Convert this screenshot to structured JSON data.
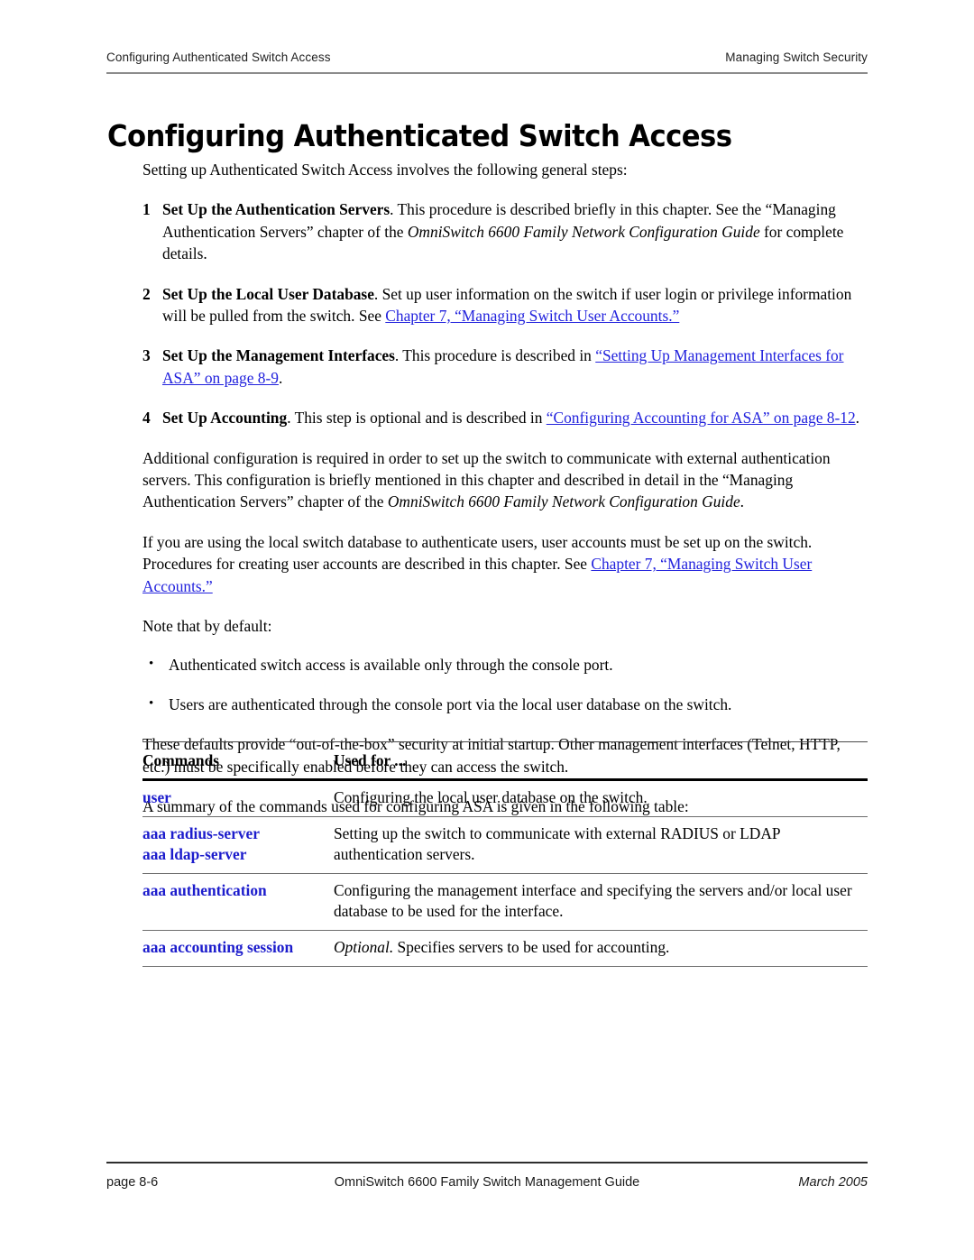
{
  "header": {
    "left": "Configuring Authenticated Switch Access",
    "right": "Managing Switch Security"
  },
  "title": "Configuring Authenticated Switch Access",
  "intro": "Setting up Authenticated Switch Access involves the following general steps:",
  "steps": [
    {
      "num": "1",
      "lead": "Set Up the Authentication Servers",
      "text_a": ". This procedure is described briefly in this chapter. See the “Managing Authentication Servers” chapter of the ",
      "italic": "OmniSwitch 6600 Family Network Configuration Guide",
      "text_b": " for complete details."
    },
    {
      "num": "2",
      "lead": "Set Up the Local User Database",
      "text_a": ". Set up user information on the switch if user login or privilege information will be pulled from the switch. See ",
      "link": "Chapter 7, “Managing Switch User Accounts.”",
      "text_b": ""
    },
    {
      "num": "3",
      "lead": "Set Up the Management Interfaces",
      "text_a": ". This procedure is described in ",
      "link": "“Setting Up Management Interfaces for ASA” on page 8-9",
      "text_b": "."
    },
    {
      "num": "4",
      "lead": "Set Up Accounting",
      "text_a": ". This step is optional and is described in ",
      "link": "“Configuring Accounting for ASA” on page 8-12",
      "text_b": "."
    }
  ],
  "para_additional": {
    "text_a": "Additional configuration is required in order to set up the switch to communicate with external authentication servers. This configuration is briefly mentioned in this chapter and described in detail in the “Managing Authentication Servers” chapter of the ",
    "italic": "OmniSwitch 6600 Family Network Configuration Guide",
    "text_b": "."
  },
  "para_localdb": {
    "text_a": "If you are using the local switch database to authenticate users, user accounts must be set up on the switch. Procedures for creating user accounts are described in this chapter. See ",
    "link": "Chapter 7, “Managing Switch User Accounts.”",
    "text_b": ""
  },
  "para_note": "Note that by default:",
  "bullets": [
    "Authenticated switch access is available only through the console port.",
    "Users are authenticated through the console port via the local user database on the switch."
  ],
  "para_defaults": "These defaults provide “out-of-the-box” security at initial startup. Other management interfaces (Telnet, HTTP, etc.) must be specifically enabled before they can access the switch.",
  "para_summary": "A summary of the commands used for configuring ASA is given in the following table:",
  "table": {
    "headers": [
      "Commands",
      "Used for ..."
    ],
    "rows": [
      {
        "cmd_line1": "user",
        "cmd_line2": "",
        "used_for": "Configuring the local user database on the switch.",
        "used_for_italic_lead": ""
      },
      {
        "cmd_line1": "aaa radius-server",
        "cmd_line2": "aaa ldap-server",
        "used_for": "Setting up the switch to communicate with external RADIUS or LDAP authentication servers.",
        "used_for_italic_lead": ""
      },
      {
        "cmd_line1": "aaa authentication",
        "cmd_line2": "",
        "used_for": "Configuring the management interface and specifying the servers and/or local user database to be used for the interface.",
        "used_for_italic_lead": ""
      },
      {
        "cmd_line1": "aaa accounting session",
        "cmd_line2": "",
        "used_for": " Specifies servers to be used for accounting.",
        "used_for_italic_lead": "Optional."
      }
    ]
  },
  "footer": {
    "page": "page 8-6",
    "guide": "OmniSwitch 6600 Family Switch Management Guide",
    "date": "March 2005"
  },
  "colors": {
    "link_blue": "#2222dd",
    "command_blue": "#1c1ccc",
    "header_rule": "#8c8c8c",
    "text": "#000000"
  }
}
